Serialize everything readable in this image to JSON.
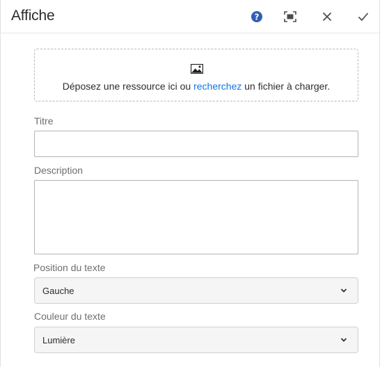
{
  "dialog": {
    "title": "Affiche",
    "help_icon": "help-icon",
    "fullscreen_icon": "fullscreen-icon",
    "close_icon": "close-icon",
    "confirm_icon": "checkmark-icon"
  },
  "dropzone": {
    "icon": "image-icon",
    "text_before": "Déposez une ressource ici ou ",
    "link": "recherchez",
    "text_after": " un fichier à charger."
  },
  "fields": {
    "title_label": "Titre",
    "title_value": "",
    "description_label": "Description",
    "description_value": "",
    "position_label": "Position du texte",
    "position_value": "Gauche",
    "color_label": "Couleur du texte",
    "color_value": "Lumière"
  },
  "colors": {
    "accent": "#1473e6",
    "help_badge": "#2f5fb3"
  }
}
